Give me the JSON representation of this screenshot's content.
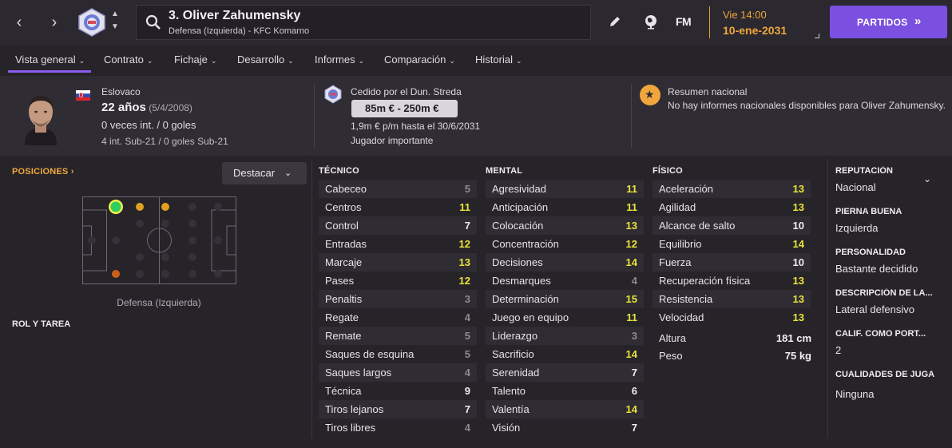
{
  "header": {
    "player_title": "3. Oliver Zahumensky",
    "player_subtitle": "Defensa (Izquierda) - KFC Komarno",
    "fm_logo": "FM",
    "date_time": "Vie 14:00",
    "date_day": "10-ene-2031",
    "partidos_label": "PARTIDOS",
    "icons": [
      "chevron-left-icon",
      "chevron-right-icon",
      "club-badge-icon",
      "search-icon",
      "pencil-icon",
      "globe-icon"
    ]
  },
  "tabs": [
    {
      "label": "Vista general"
    },
    {
      "label": "Contrato"
    },
    {
      "label": "Fichaje"
    },
    {
      "label": "Desarrollo"
    },
    {
      "label": "Informes"
    },
    {
      "label": "Comparación"
    },
    {
      "label": "Historial"
    }
  ],
  "info": {
    "nationality": "Eslovaco",
    "age": "22 años",
    "dob": "(5/4/2008)",
    "caps": "0 veces int. / 0 goles",
    "u21_caps": "4 int. Sub-21 / 0 goles Sub-21",
    "loan": "Cedido por el Dun. Streda",
    "value_range": "85m € - 250m €",
    "wage": "1,9m € p/m hasta el 30/6/2031",
    "squad_status": "Jugador importante",
    "national_summary_title": "Resumen nacional",
    "national_summary_text": "No hay informes nacionales disponibles para Oliver Zahumensky."
  },
  "positions": {
    "header": "POSICIONES",
    "highlight_button": "Destacar",
    "caption": "Defensa (Izquierda)",
    "role_header": "ROL Y TAREA"
  },
  "columns": {
    "tecnico": {
      "title": "TÉCNICO",
      "items": [
        {
          "name": "Cabeceo",
          "value": 5
        },
        {
          "name": "Centros",
          "value": 11
        },
        {
          "name": "Control",
          "value": 7
        },
        {
          "name": "Entradas",
          "value": 12
        },
        {
          "name": "Marcaje",
          "value": 13
        },
        {
          "name": "Pases",
          "value": 12
        },
        {
          "name": "Penaltis",
          "value": 3
        },
        {
          "name": "Regate",
          "value": 4
        },
        {
          "name": "Remate",
          "value": 5
        },
        {
          "name": "Saques de esquina",
          "value": 5
        },
        {
          "name": "Saques largos",
          "value": 4
        },
        {
          "name": "Técnica",
          "value": 9
        },
        {
          "name": "Tiros lejanos",
          "value": 7
        },
        {
          "name": "Tiros libres",
          "value": 4
        }
      ]
    },
    "mental": {
      "title": "MENTAL",
      "items": [
        {
          "name": "Agresividad",
          "value": 11
        },
        {
          "name": "Anticipación",
          "value": 11
        },
        {
          "name": "Colocación",
          "value": 13
        },
        {
          "name": "Concentración",
          "value": 12
        },
        {
          "name": "Decisiones",
          "value": 14
        },
        {
          "name": "Desmarques",
          "value": 4
        },
        {
          "name": "Determinación",
          "value": 15
        },
        {
          "name": "Juego en equipo",
          "value": 11
        },
        {
          "name": "Liderazgo",
          "value": 3
        },
        {
          "name": "Sacrificio",
          "value": 14
        },
        {
          "name": "Serenidad",
          "value": 7
        },
        {
          "name": "Talento",
          "value": 6
        },
        {
          "name": "Valentía",
          "value": 14
        },
        {
          "name": "Visión",
          "value": 7
        }
      ]
    },
    "fisico": {
      "title": "FÍSICO",
      "items": [
        {
          "name": "Aceleración",
          "value": 13
        },
        {
          "name": "Agilidad",
          "value": 13
        },
        {
          "name": "Alcance de salto",
          "value": 10
        },
        {
          "name": "Equilibrio",
          "value": 14
        },
        {
          "name": "Fuerza",
          "value": 10
        },
        {
          "name": "Recuperación física",
          "value": 13
        },
        {
          "name": "Resistencia",
          "value": 13
        },
        {
          "name": "Velocidad",
          "value": 13
        }
      ],
      "height_label": "Altura",
      "height_value": "181 cm",
      "weight_label": "Peso",
      "weight_value": "75 kg"
    }
  },
  "side": {
    "reputation_label": "REPUTACIÓN",
    "reputation_value": "Nacional",
    "foot_label": "PIERNA BUENA",
    "foot_value": "Izquierda",
    "personality_label": "PERSONALIDAD",
    "personality_value": "Bastante decidido",
    "description_label": "DESCRIPCIÓN DE LA...",
    "description_value": "Lateral defensivo",
    "gk_rating_label": "CALIF. COMO PORT...",
    "gk_rating_value": "2",
    "qualities_label": "CUALIDADES DE JUGA",
    "qualities_value": "Ninguna"
  },
  "colors": {
    "accent": "#7b4fe0",
    "orange": "#f0a63c",
    "highlight": "#e9e23a",
    "low": "#8d8a92"
  }
}
